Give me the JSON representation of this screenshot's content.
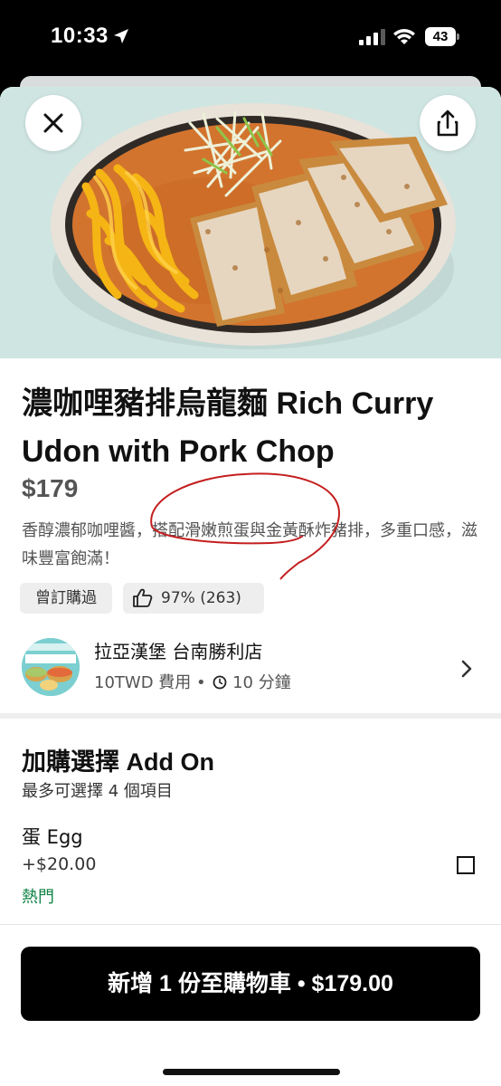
{
  "status_bar": {
    "time": "10:33",
    "battery": "43",
    "icons": [
      "location-arrow-icon",
      "signal-icon",
      "wifi-icon",
      "battery-icon"
    ]
  },
  "header": {
    "close_icon": "close-icon",
    "share_icon": "share-icon"
  },
  "product": {
    "title": "濃咖哩豬排烏龍麵 Rich Curry Udon with Pork Chop",
    "price": "$179",
    "description": "香醇濃郁咖哩醬，搭配滑嫩煎蛋與金黃酥炸豬排，多重口感，滋味豐富飽滿！",
    "badges": {
      "ordered_before": "曾訂購過",
      "rating": "97% (263)"
    },
    "annotation_color": "#c41e1e"
  },
  "store": {
    "name": "拉亞漢堡 台南勝利店",
    "fee": "10TWD 費用 •",
    "time": "10 分鐘"
  },
  "addons": {
    "title": "加購選擇 Add On",
    "subtitle": "最多可選擇 4 個項目",
    "options": [
      {
        "name": "蛋 Egg",
        "price": "+$20.00",
        "tag": "熱門",
        "checked": false
      }
    ]
  },
  "cart_button": {
    "label": "新增 1 份至購物車 • $179.00"
  },
  "colors": {
    "popular_tag": "#0e8345",
    "hero_background": "#cfe5e2",
    "button_background": "#000000"
  }
}
